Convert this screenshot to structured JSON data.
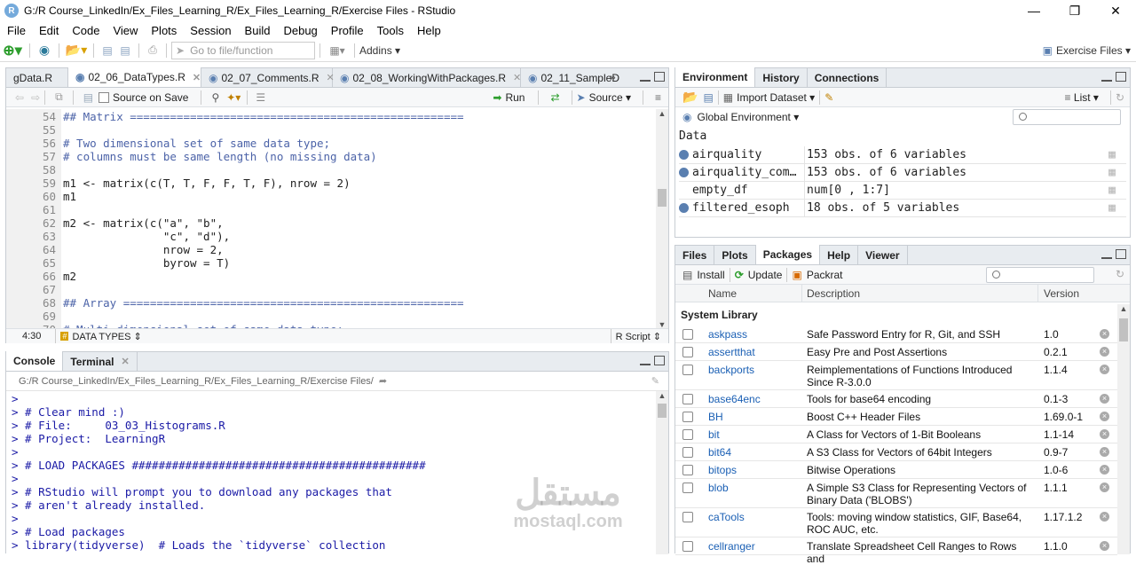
{
  "window": {
    "title": "G:/R Course_LinkedIn/Ex_Files_Learning_R/Ex_Files_Learning_R/Exercise Files - RStudio",
    "logo": "R"
  },
  "menu": [
    "File",
    "Edit",
    "Code",
    "View",
    "Plots",
    "Session",
    "Build",
    "Debug",
    "Profile",
    "Tools",
    "Help"
  ],
  "toolbar": {
    "goto_placeholder": "Go to file/function",
    "addins": "Addins",
    "project": "Exercise Files"
  },
  "editor": {
    "tabs": [
      {
        "label": "gData.R"
      },
      {
        "label": "02_06_DataTypes.R"
      },
      {
        "label": "02_07_Comments.R"
      },
      {
        "label": "02_08_WorkingWithPackages.R"
      },
      {
        "label": "02_11_SampleD"
      }
    ],
    "source_on_save": "Source on Save",
    "run": "Run",
    "source": "Source",
    "lines": [
      {
        "n": "54",
        "t": "## Matrix =================================================="
      },
      {
        "n": "55",
        "t": ""
      },
      {
        "n": "56",
        "t": "# Two dimensional set of same data type;"
      },
      {
        "n": "57",
        "t": "# columns must be same length (no missing data)"
      },
      {
        "n": "58",
        "t": ""
      },
      {
        "n": "59",
        "t": "m1 <- matrix(c(T, T, F, F, T, F), nrow = 2)"
      },
      {
        "n": "60",
        "t": "m1"
      },
      {
        "n": "61",
        "t": ""
      },
      {
        "n": "62",
        "t": "m2 <- matrix(c(\"a\", \"b\","
      },
      {
        "n": "63",
        "t": "               \"c\", \"d\"),"
      },
      {
        "n": "64",
        "t": "               nrow = 2,"
      },
      {
        "n": "65",
        "t": "               byrow = T)"
      },
      {
        "n": "66",
        "t": "m2"
      },
      {
        "n": "67",
        "t": ""
      },
      {
        "n": "68",
        "t": "## Array ==================================================="
      },
      {
        "n": "69",
        "t": ""
      },
      {
        "n": "70",
        "t": "# Multi-dimensional set of same data type;"
      }
    ],
    "status_pos": "4:30",
    "status_section": "DATA TYPES",
    "status_lang": "R Script"
  },
  "console": {
    "tabs": [
      {
        "label": "Console"
      },
      {
        "label": "Terminal"
      }
    ],
    "path": "G:/R Course_LinkedIn/Ex_Files_Learning_R/Ex_Files_Learning_R/Exercise Files/",
    "lines": [
      ">",
      "> # Clear mind :)",
      "> # File:     03_03_Histograms.R",
      "> # Project:  LearningR",
      ">",
      "> # LOAD PACKAGES ############################################",
      ">",
      "> # RStudio will prompt you to download any packages that",
      "> # aren't already installed.",
      ">",
      "> # Load packages",
      "> library(tidyverse)  # Loads the `tidyverse` collection"
    ]
  },
  "environment": {
    "tabs": [
      {
        "label": "Environment"
      },
      {
        "label": "History"
      },
      {
        "label": "Connections"
      }
    ],
    "import_dataset": "Import Dataset",
    "list_mode": "List",
    "scope": "Global Environment",
    "section": "Data",
    "rows": [
      {
        "name": "airquality",
        "value": "153 obs. of 6 variables",
        "dot": true
      },
      {
        "name": "airquality_com…",
        "value": "153 obs. of 6 variables",
        "dot": true
      },
      {
        "name": "empty_df",
        "value": "num[0 , 1:7]",
        "dot": false
      },
      {
        "name": "filtered_esoph",
        "value": "18 obs. of 5 variables",
        "dot": true
      }
    ]
  },
  "packages": {
    "tabs": [
      {
        "label": "Files"
      },
      {
        "label": "Plots"
      },
      {
        "label": "Packages"
      },
      {
        "label": "Help"
      },
      {
        "label": "Viewer"
      }
    ],
    "install": "Install",
    "update": "Update",
    "packrat": "Packrat",
    "headers": {
      "name": "Name",
      "description": "Description",
      "version": "Version"
    },
    "section": "System Library",
    "rows": [
      {
        "name": "askpass",
        "desc": "Safe Password Entry for R, Git, and SSH",
        "ver": "1.0",
        "h": 20
      },
      {
        "name": "assertthat",
        "desc": "Easy Pre and Post Assertions",
        "ver": "0.2.1",
        "h": 20
      },
      {
        "name": "backports",
        "desc": "Reimplementations of Functions Introduced Since R-3.0.0",
        "ver": "1.1.4",
        "h": 33
      },
      {
        "name": "base64enc",
        "desc": "Tools for base64 encoding",
        "ver": "0.1-3",
        "h": 20
      },
      {
        "name": "BH",
        "desc": "Boost C++ Header Files",
        "ver": "1.69.0-1",
        "h": 20
      },
      {
        "name": "bit",
        "desc": "A Class for Vectors of 1-Bit Booleans",
        "ver": "1.1-14",
        "h": 20
      },
      {
        "name": "bit64",
        "desc": "A S3 Class for Vectors of 64bit Integers",
        "ver": "0.9-7",
        "h": 20
      },
      {
        "name": "bitops",
        "desc": "Bitwise Operations",
        "ver": "1.0-6",
        "h": 20
      },
      {
        "name": "blob",
        "desc": "A Simple S3 Class for Representing Vectors of Binary Data ('BLOBS')",
        "ver": "1.1.1",
        "h": 33
      },
      {
        "name": "caTools",
        "desc": "Tools: moving window statistics, GIF, Base64, ROC AUC, etc.",
        "ver": "1.17.1.2",
        "h": 33
      },
      {
        "name": "cellranger",
        "desc": "Translate Spreadsheet Cell Ranges to Rows and",
        "ver": "1.1.0",
        "h": 20
      }
    ]
  },
  "watermark": {
    "ar": "مستقل",
    "en": "mostaql.com"
  }
}
